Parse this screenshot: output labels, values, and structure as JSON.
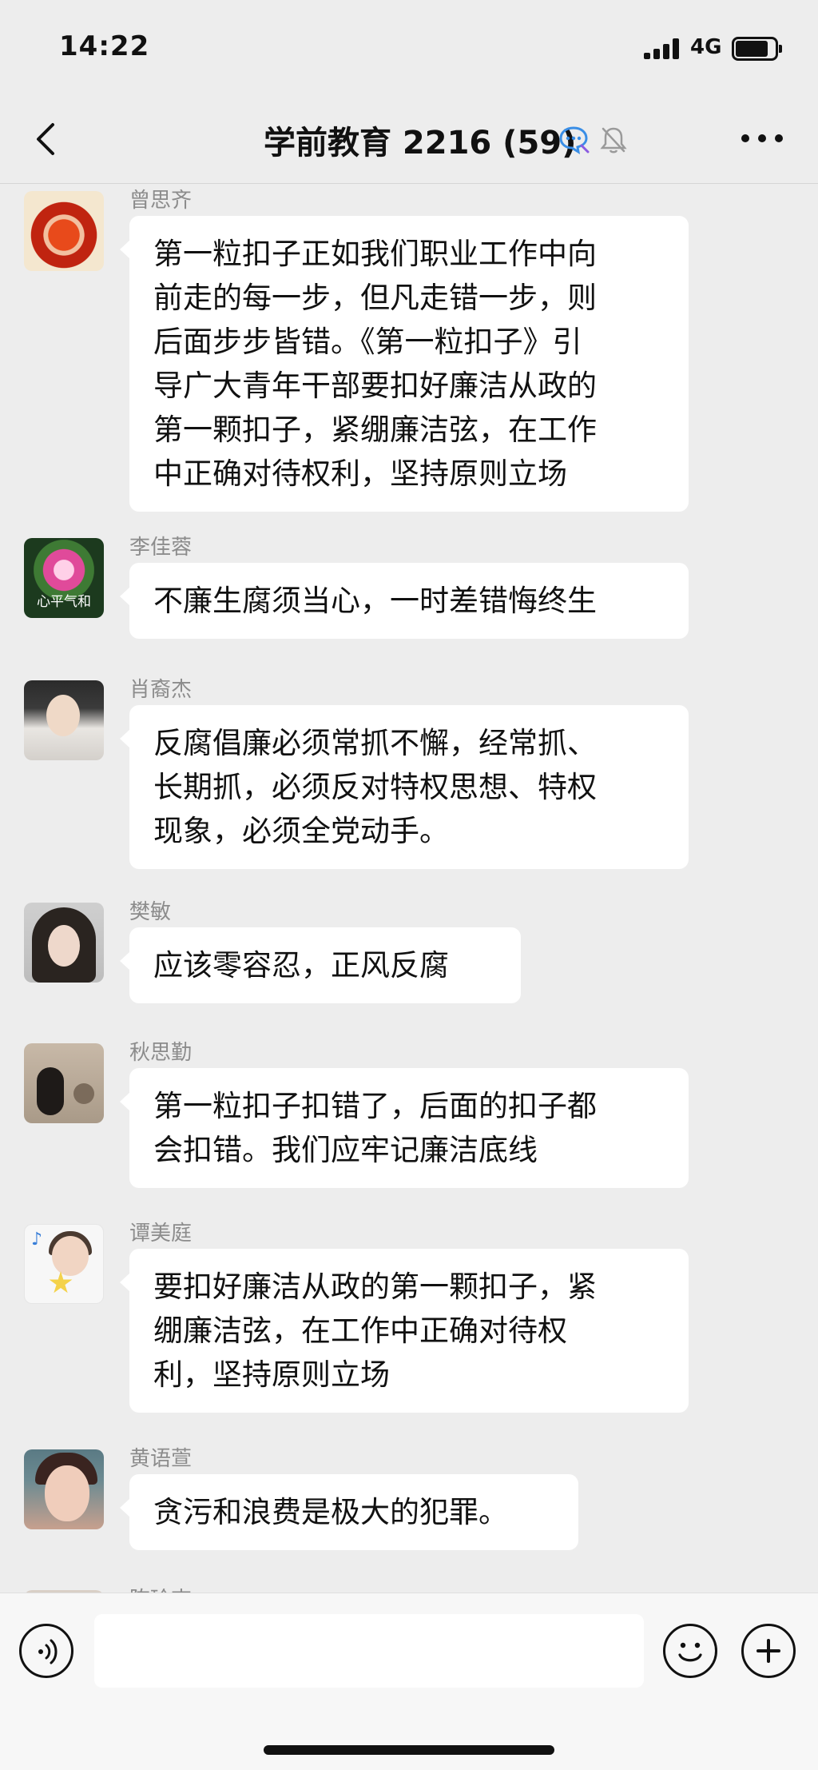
{
  "status_bar": {
    "time": "14:22",
    "network": "4G",
    "icons": [
      "signal-icon",
      "battery-icon"
    ]
  },
  "header": {
    "title": "学前教育 2216 (59)",
    "icons": [
      "back-icon",
      "chat-settings-icon",
      "mute-icon",
      "more-icon"
    ]
  },
  "messages": [
    {
      "sender": "曾思齐",
      "text": [
        "第一粒扣子正如我们职业工作中向",
        "前走的每一步，但凡走错一步，则",
        "后面步步皆错。《第一粒扣子》引",
        "导广大青年干部要扣好廉洁从政的",
        "第一颗扣子，紧绷廉洁弦，在工作",
        "中正确对待权利，坚持原则立场"
      ]
    },
    {
      "sender": "李佳蓉",
      "avatar_caption": "心平气和",
      "text": [
        "不廉生腐须当心，一时差错悔终生"
      ]
    },
    {
      "sender": "肖裔杰",
      "text": [
        "反腐倡廉必须常抓不懈，经常抓、",
        "长期抓，必须反对特权思想、特权",
        "现象，必须全党动手。"
      ]
    },
    {
      "sender": "樊敏",
      "text": [
        "应该零容忍，正风反腐"
      ]
    },
    {
      "sender": "秋思勤",
      "text": [
        "第一粒扣子扣错了，后面的扣子都",
        "会扣错。我们应牢记廉洁底线"
      ]
    },
    {
      "sender": "谭美庭",
      "text": [
        "要扣好廉洁从政的第一颗扣子，紧",
        "绷廉洁弦，在工作中正确对待权",
        "利，坚持原则立场"
      ]
    },
    {
      "sender": "黄语萱",
      "text": [
        "贪污和浪费是极大的犯罪。"
      ]
    },
    {
      "sender": "陈玲吉"
    }
  ],
  "input_bar": {
    "placeholder": "",
    "icons": [
      "voice-icon",
      "emoji-icon",
      "plus-icon"
    ]
  }
}
